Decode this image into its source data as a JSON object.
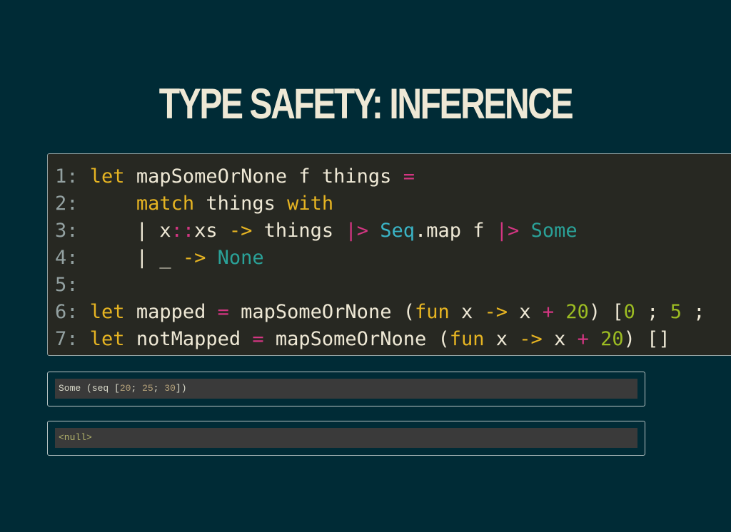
{
  "slide": {
    "title": "TYPE SAFETY: INFERENCE"
  },
  "code": {
    "lines": [
      {
        "number": "1:",
        "tokens": [
          "let",
          " mapSomeOrNone f things ",
          "="
        ]
      },
      {
        "number": "2:",
        "tokens": [
          "    ",
          "match",
          " things ",
          "with"
        ]
      },
      {
        "number": "3:",
        "tokens": [
          "    | x",
          "::",
          "xs ",
          "->",
          " things ",
          "|>",
          " ",
          "Seq",
          ".map f ",
          "|>",
          " ",
          "Some"
        ]
      },
      {
        "number": "4:",
        "tokens": [
          "    | _ ",
          "->",
          " ",
          "None"
        ]
      },
      {
        "number": "5:",
        "tokens": []
      },
      {
        "number": "6:",
        "tokens": [
          "let",
          " mapped ",
          "=",
          " mapSomeOrNone (",
          "fun",
          " x ",
          "->",
          " x ",
          "+",
          " ",
          "20",
          ") [",
          "0",
          " ; ",
          "5",
          " ;"
        ]
      },
      {
        "number": "7:",
        "tokens": [
          "let",
          " notMapped ",
          "=",
          " mapSomeOrNone (",
          "fun",
          " x ",
          "->",
          " x ",
          "+",
          " ",
          "20",
          ") []"
        ]
      }
    ]
  },
  "outputs": [
    {
      "tokens": [
        "Some (se",
        "q ",
        "[",
        "20",
        "; ",
        "25",
        "; ",
        "30",
        "])"
      ]
    },
    {
      "tokens": [
        "<null>"
      ]
    }
  ]
}
